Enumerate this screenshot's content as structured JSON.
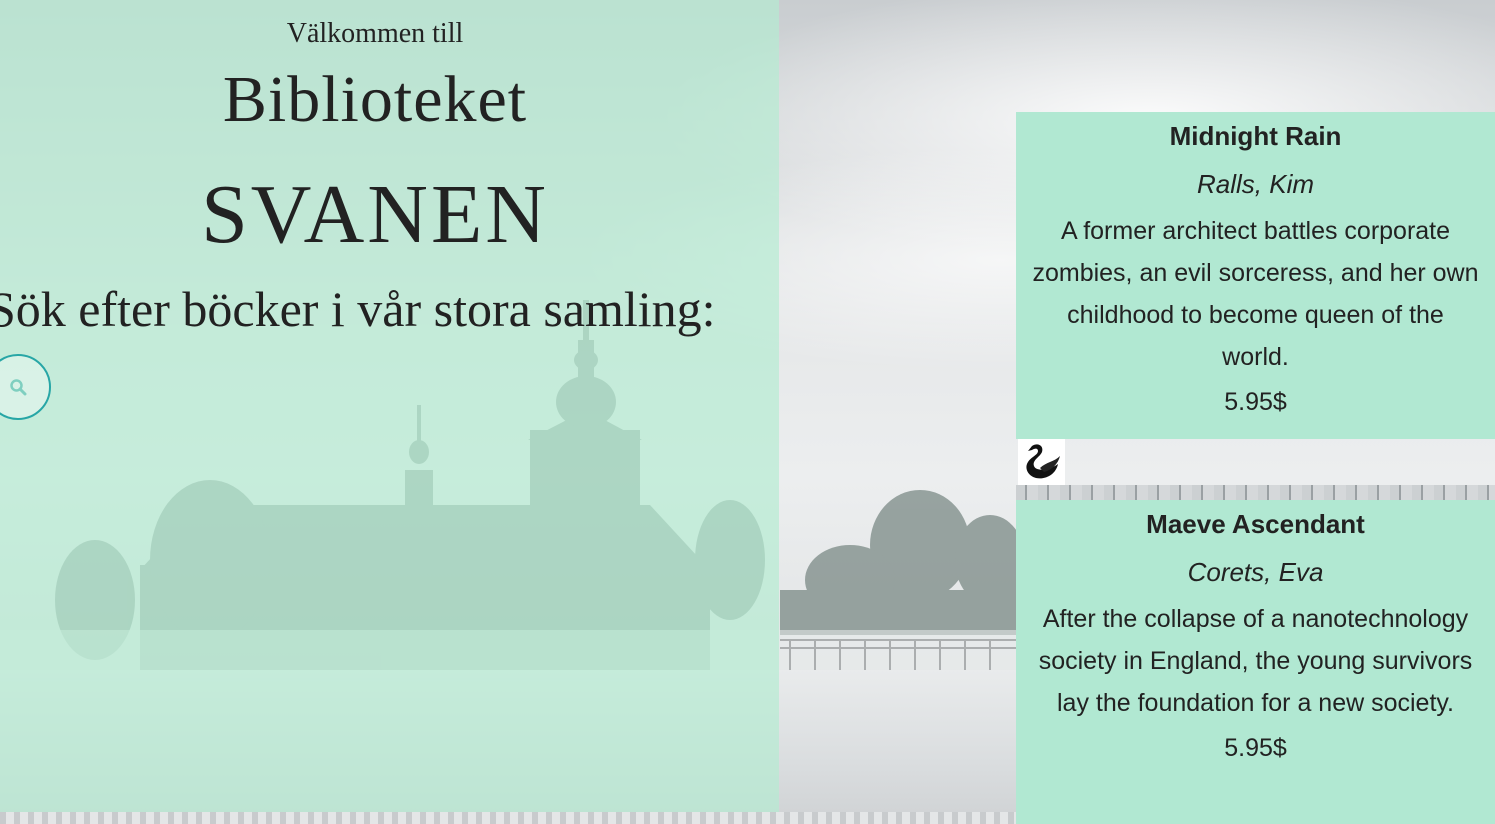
{
  "hero": {
    "welcome": "Välkommen till",
    "library": "Biblioteket",
    "name": "SVANEN",
    "search_prompt": "Sök efter böcker i vår stora samling:"
  },
  "search": {
    "icon": "search-icon"
  },
  "books": [
    {
      "title": "Midnight Rain",
      "author": "Ralls, Kim",
      "description": "A former architect battles corporate zombies, an evil sorceress, and her own childhood to become queen of the world.",
      "price": "5.95$"
    },
    {
      "title": "Maeve Ascendant",
      "author": "Corets, Eva",
      "description": "After the collapse of a nanotechnology society in England, the young survivors lay the foundation for a new society.",
      "price": "5.95$"
    }
  ],
  "logo": {
    "icon": "swan-icon"
  },
  "colors": {
    "tint": "#b4ecd2",
    "card": "#b1e8d2",
    "accent": "#27a6a6",
    "text": "#222222"
  }
}
